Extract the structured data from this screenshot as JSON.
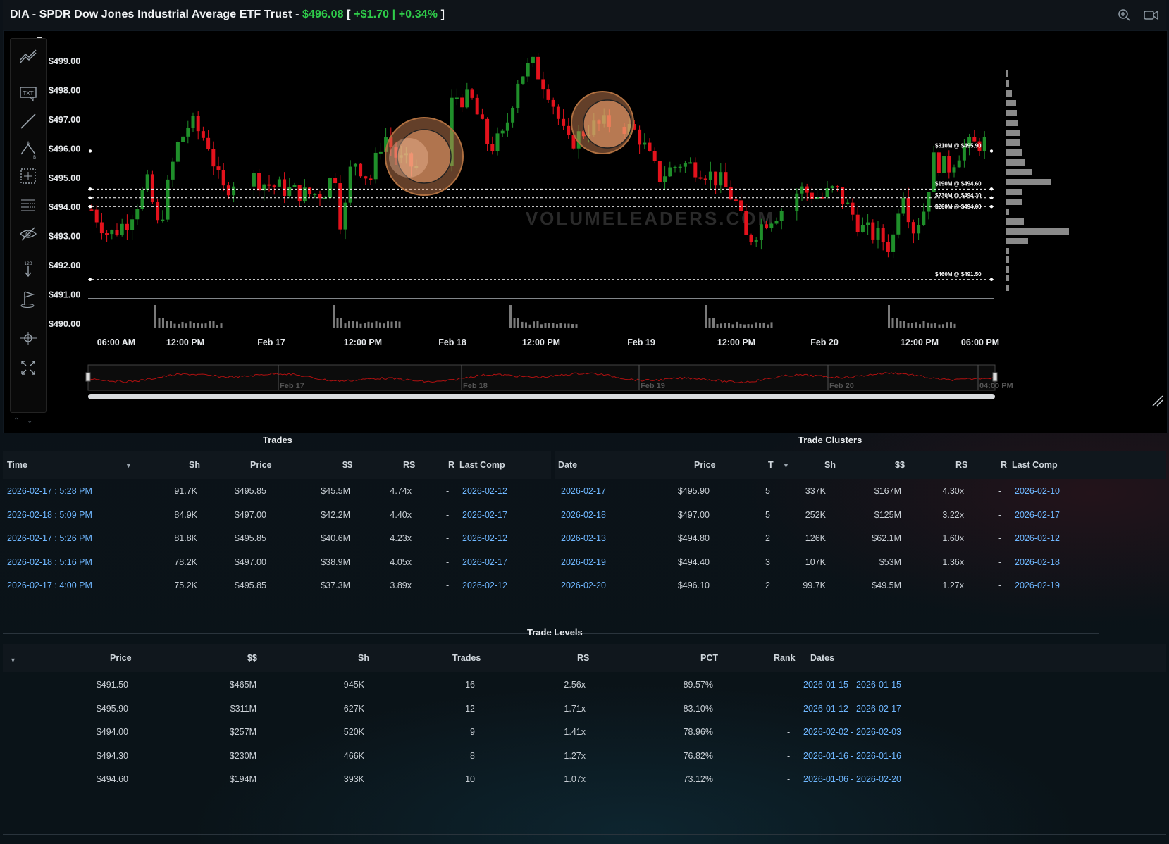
{
  "header": {
    "ticker_name": "DIA - SPDR Dow Jones Industrial Average ETF Trust - ",
    "price": "$496.08",
    "bracket_open": " [ ",
    "change": "+$1.70 | +0.34%",
    "bracket_close": " ]",
    "icons": [
      "zoom-in-icon",
      "video-camera-icon"
    ],
    "colors": {
      "up": "#2fcc4a",
      "text": "#f1f3f5"
    }
  },
  "chart": {
    "watermark": "VOLUMELEADERS.COM",
    "y_labels": [
      "$499.00",
      "$498.00",
      "$497.00",
      "$496.00",
      "$495.00",
      "$494.00",
      "$493.00",
      "$492.00",
      "$491.00",
      "$490.00"
    ],
    "x_labels": [
      "06:00 AM",
      "12:00 PM",
      "Feb 17",
      "12:00 PM",
      "Feb 18",
      "12:00 PM",
      "Feb 19",
      "12:00 PM",
      "Feb 20",
      "12:00 PM",
      "06:00 PM"
    ],
    "level_tags": [
      "$310M @ $495.90",
      "$190M @ $494.60",
      "$230M @ $494.30",
      "$260M @ $494.00",
      "$460M @ $491.50"
    ],
    "navigator_labels": [
      "Feb 17",
      "Feb 18",
      "Feb 19",
      "Feb 20",
      "04:00 PM"
    ],
    "colors": {
      "up": "#1f8f2a",
      "down": "#e3121c",
      "bubble": "#f0a070",
      "level": "#ffffff"
    },
    "toolbar_icons": [
      "trend-lines-icon",
      "text-annotation-icon",
      "line-draw-icon",
      "pattern-draw-icon",
      "crosshair-measure-icon",
      "fibonacci-icon",
      "hide-drawings-icon",
      "order-count-icon",
      "flag-marker-icon",
      "zoom-pan-icon",
      "fullscreen-icon"
    ],
    "chart_data": {
      "type": "candlestick",
      "ylim": [
        490,
        499.5
      ],
      "candles_series": "intraday 5-min candles, Feb 16 06:00 AM to Feb 20 06:00 PM",
      "trade_levels_shown": [
        495.9,
        494.6,
        494.3,
        494.0,
        491.5
      ],
      "volume_profile": "horizontal histogram, peak near $493.5 and $495.2"
    }
  },
  "trades": {
    "title": "Trades",
    "columns": [
      "Time",
      "Sh",
      "Price",
      "$$",
      "RS",
      "R",
      "Last Comp"
    ],
    "rows": [
      {
        "time": "2026-02-17 : 5:28 PM",
        "sh": "91.7K",
        "price": "$495.85",
        "dollars": "$45.5M",
        "rs": "4.74x",
        "r": "-",
        "last": "2026-02-12"
      },
      {
        "time": "2026-02-18 : 5:09 PM",
        "sh": "84.9K",
        "price": "$497.00",
        "dollars": "$42.2M",
        "rs": "4.40x",
        "r": "-",
        "last": "2026-02-17"
      },
      {
        "time": "2026-02-17 : 5:26 PM",
        "sh": "81.8K",
        "price": "$495.85",
        "dollars": "$40.6M",
        "rs": "4.23x",
        "r": "-",
        "last": "2026-02-12"
      },
      {
        "time": "2026-02-18 : 5:16 PM",
        "sh": "78.2K",
        "price": "$497.00",
        "dollars": "$38.9M",
        "rs": "4.05x",
        "r": "-",
        "last": "2026-02-17"
      },
      {
        "time": "2026-02-17 : 4:00 PM",
        "sh": "75.2K",
        "price": "$495.85",
        "dollars": "$37.3M",
        "rs": "3.89x",
        "r": "-",
        "last": "2026-02-12"
      }
    ]
  },
  "clusters": {
    "title": "Trade Clusters",
    "columns": [
      "Date",
      "Price",
      "T",
      "Sh",
      "$$",
      "RS",
      "R",
      "Last Comp"
    ],
    "rows": [
      {
        "date": "2026-02-17",
        "price": "$495.90",
        "t": "5",
        "sh": "337K",
        "dollars": "$167M",
        "rs": "4.30x",
        "r": "-",
        "last": "2026-02-10"
      },
      {
        "date": "2026-02-18",
        "price": "$497.00",
        "t": "5",
        "sh": "252K",
        "dollars": "$125M",
        "rs": "3.22x",
        "r": "-",
        "last": "2026-02-17"
      },
      {
        "date": "2026-02-13",
        "price": "$494.80",
        "t": "2",
        "sh": "126K",
        "dollars": "$62.1M",
        "rs": "1.60x",
        "r": "-",
        "last": "2026-02-12"
      },
      {
        "date": "2026-02-19",
        "price": "$494.40",
        "t": "3",
        "sh": "107K",
        "dollars": "$53M",
        "rs": "1.36x",
        "r": "-",
        "last": "2026-02-18"
      },
      {
        "date": "2026-02-20",
        "price": "$496.10",
        "t": "2",
        "sh": "99.7K",
        "dollars": "$49.5M",
        "rs": "1.27x",
        "r": "-",
        "last": "2026-02-19"
      }
    ]
  },
  "levels": {
    "title": "Trade Levels",
    "columns": [
      "Price",
      "$$",
      "Sh",
      "Trades",
      "RS",
      "PCT",
      "Rank",
      "Dates"
    ],
    "rows": [
      {
        "price": "$491.50",
        "dollars": "$465M",
        "sh": "945K",
        "trades": "16",
        "rs": "2.56x",
        "pct": "89.57%",
        "rank": "-",
        "dates": "2026-01-15 - 2026-01-15"
      },
      {
        "price": "$495.90",
        "dollars": "$311M",
        "sh": "627K",
        "trades": "12",
        "rs": "1.71x",
        "pct": "83.10%",
        "rank": "-",
        "dates": "2026-01-12 - 2026-02-17"
      },
      {
        "price": "$494.00",
        "dollars": "$257M",
        "sh": "520K",
        "trades": "9",
        "rs": "1.41x",
        "pct": "78.96%",
        "rank": "-",
        "dates": "2026-02-02 - 2026-02-03"
      },
      {
        "price": "$494.30",
        "dollars": "$230M",
        "sh": "466K",
        "trades": "8",
        "rs": "1.27x",
        "pct": "76.82%",
        "rank": "-",
        "dates": "2026-01-16 - 2026-01-16"
      },
      {
        "price": "$494.60",
        "dollars": "$194M",
        "sh": "393K",
        "trades": "10",
        "rs": "1.07x",
        "pct": "73.12%",
        "rank": "-",
        "dates": "2026-01-06 - 2026-02-20"
      }
    ]
  }
}
